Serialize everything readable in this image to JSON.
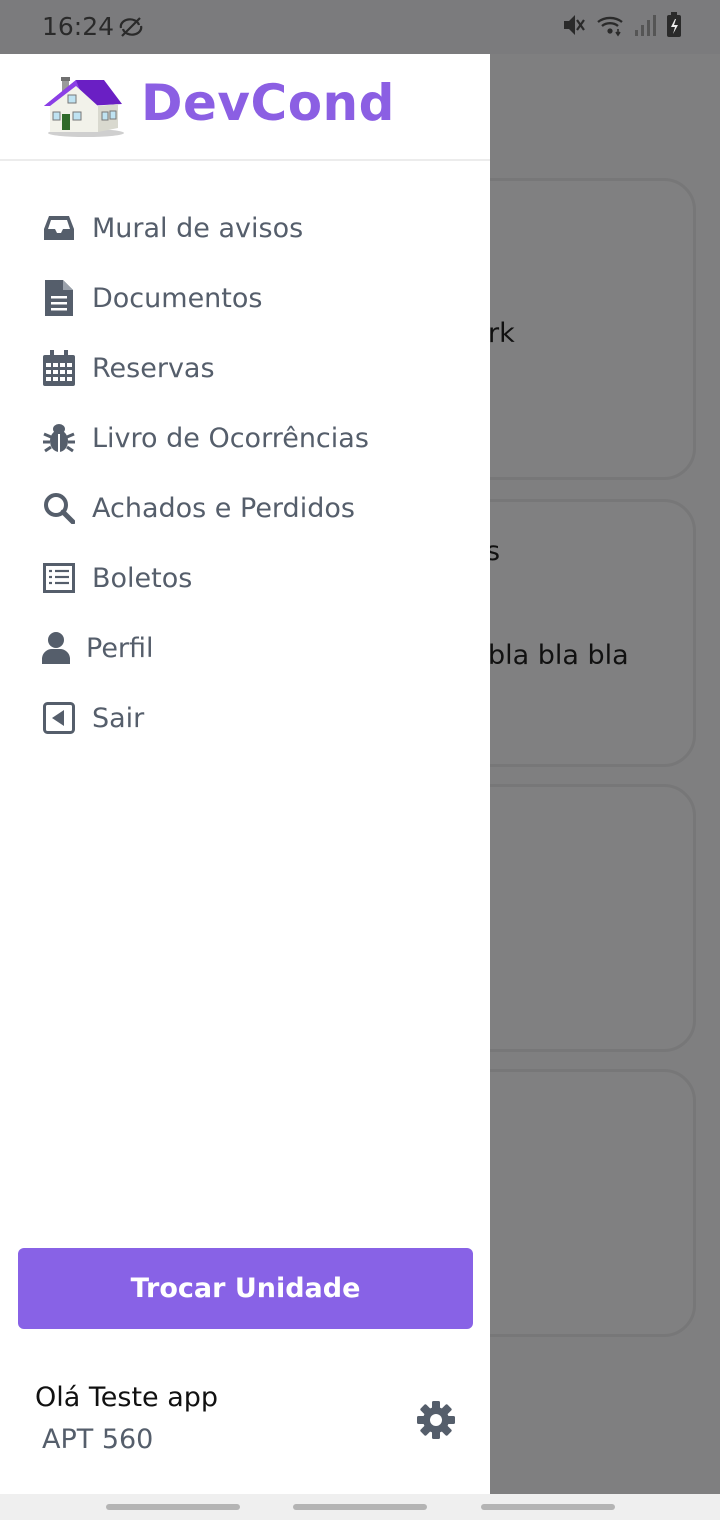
{
  "status_bar": {
    "time": "16:24",
    "icons": [
      "sync-off-icon",
      "mute-icon",
      "wifi-icon",
      "signal-icon",
      "battery-charging-icon"
    ]
  },
  "background": {
    "fragments": [
      "rk",
      "s",
      "bla bla bla"
    ]
  },
  "drawer": {
    "app_name": "DevCond",
    "logo_icon": "house-icon",
    "menu": [
      {
        "label": "Mural de avisos",
        "icon": "inbox-icon"
      },
      {
        "label": "Documentos",
        "icon": "file-text-icon"
      },
      {
        "label": "Reservas",
        "icon": "calendar-icon"
      },
      {
        "label": "Livro de Ocorrências",
        "icon": "bug-icon"
      },
      {
        "label": "Achados e Perdidos",
        "icon": "search-icon"
      },
      {
        "label": "Boletos",
        "icon": "receipt-icon"
      },
      {
        "label": "Perfil",
        "icon": "user-icon"
      },
      {
        "label": "Sair",
        "icon": "exit-icon"
      }
    ],
    "switch_button": "Trocar Unidade",
    "greeting": "Olá Teste app",
    "unit": "APT 560",
    "settings_icon": "gear-icon"
  },
  "colors": {
    "accent": "#8862e6",
    "logo_text": "#8b5fe3",
    "menu_text": "#555e6b",
    "overlay": "#7f7f80"
  }
}
